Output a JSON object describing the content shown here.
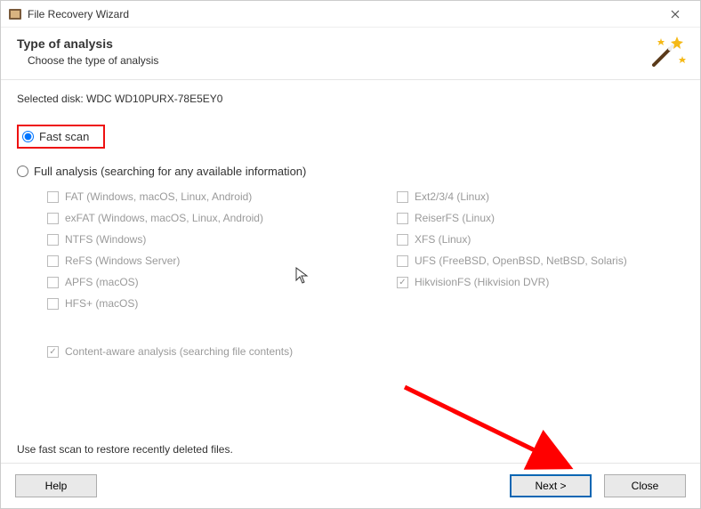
{
  "window": {
    "title": "File Recovery Wizard"
  },
  "header": {
    "heading": "Type of analysis",
    "subtitle": "Choose the type of analysis"
  },
  "selected_disk": {
    "label": "Selected disk: ",
    "value": "WDC WD10PURX-78E5EY0"
  },
  "options": {
    "fast_scan": {
      "label": "Fast scan",
      "selected": true
    },
    "full_analysis": {
      "label": "Full analysis (searching for any available information)",
      "selected": false
    }
  },
  "filesystems": {
    "left": [
      {
        "key": "fat",
        "label": "FAT (Windows, macOS, Linux, Android)",
        "checked": false
      },
      {
        "key": "exfat",
        "label": "exFAT (Windows, macOS, Linux, Android)",
        "checked": false
      },
      {
        "key": "ntfs",
        "label": "NTFS (Windows)",
        "checked": false
      },
      {
        "key": "refs",
        "label": "ReFS (Windows Server)",
        "checked": false
      },
      {
        "key": "apfs",
        "label": "APFS (macOS)",
        "checked": false
      },
      {
        "key": "hfs",
        "label": "HFS+ (macOS)",
        "checked": false
      }
    ],
    "right": [
      {
        "key": "ext",
        "label": "Ext2/3/4 (Linux)",
        "checked": false
      },
      {
        "key": "reiser",
        "label": "ReiserFS (Linux)",
        "checked": false
      },
      {
        "key": "xfs",
        "label": "XFS (Linux)",
        "checked": false
      },
      {
        "key": "ufs",
        "label": "UFS (FreeBSD, OpenBSD, NetBSD, Solaris)",
        "checked": false
      },
      {
        "key": "hikvision",
        "label": "HikvisionFS (Hikvision DVR)",
        "checked": true
      }
    ]
  },
  "content_aware": {
    "label": "Content-aware analysis (searching file contents)",
    "checked": true
  },
  "hint": "Use fast scan to restore recently deleted files.",
  "buttons": {
    "help": "Help",
    "next": "Next >",
    "close": "Close"
  }
}
